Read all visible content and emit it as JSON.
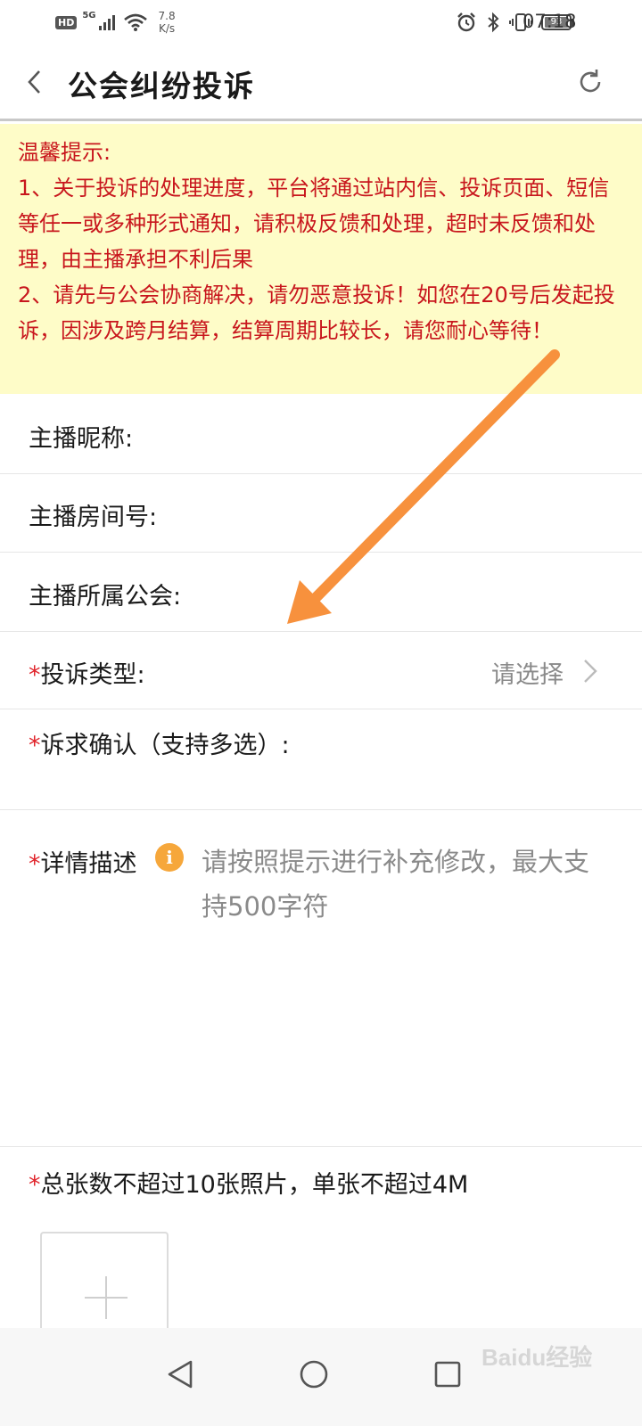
{
  "status_bar": {
    "hd": "HD",
    "network": "5G",
    "speed_value": "7.8",
    "speed_unit": "K/s",
    "battery": "93",
    "time": "07:18"
  },
  "header": {
    "title": "公会纠纷投诉"
  },
  "notice": {
    "heading": "温馨提示:",
    "line1": "1、关于投诉的处理进度，平台将通过站内信、投诉页面、短信等任一或多种形式通知，请积极反馈和处理，超时未反馈和处理，由主播承担不利后果",
    "line2": "2、请先与公会协商解决，请勿恶意投诉！如您在20号后发起投诉，因涉及跨月结算，结算周期比较长，请您耐心等待！"
  },
  "form": {
    "required_mark": "*",
    "nickname_label": "主播昵称:",
    "room_label": "主播房间号:",
    "guild_label": "主播所属公会:",
    "type_label": "投诉类型:",
    "type_placeholder": "请选择",
    "confirm_label": "诉求确认（支持多选）:",
    "detail_label": "详情描述",
    "detail_placeholder": "请按照提示进行补充修改，最大支持500字符",
    "photo_label": "总张数不超过10张照片，单张不超过4M"
  },
  "watermark": "Baidu经验",
  "colors": {
    "notice_bg": "#fefcc8",
    "notice_text": "#c8161d",
    "required": "#e0242b",
    "info_icon": "#f6a73b",
    "arrow": "#f7913d"
  }
}
